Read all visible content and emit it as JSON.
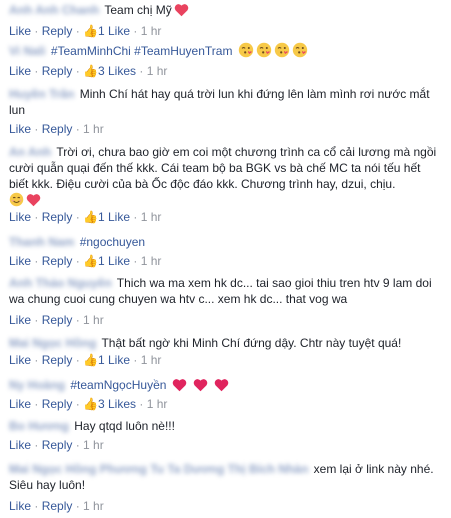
{
  "colors": {
    "link": "#365899",
    "meta": "#90949c",
    "text": "#1d2129",
    "heart": "#e9435f",
    "like_icon": "#5890ff"
  },
  "actions": {
    "like": "Like",
    "reply": "Reply",
    "sep": " · ",
    "thumb": "👍"
  },
  "comments": [
    {
      "author": "Anh Anh Chanh",
      "text": "Team chị Mỹ",
      "likes": "1 Like",
      "time": "1 hr",
      "emoji": [
        "heart"
      ]
    },
    {
      "author": "Vi Nali",
      "text": "#TeamMinhChi #TeamHuyenTram",
      "likes": "3 Likes",
      "time": "1 hr",
      "emoji": [
        "kiss",
        "kiss",
        "kiss",
        "kiss"
      ]
    },
    {
      "author": "Huyền Trân",
      "text": "Minh Chí hát hay quá trời lun khi đứng lên làm mình rơi nước mắt lun",
      "likes": "",
      "time": "1 hr",
      "emoji": []
    },
    {
      "author": "An Anh",
      "text": "Trời ơi, chưa bao giờ em coi một chương trình ca cổ cải lương mà ngồi cười quẫn quại đến thế kkk. Cái team bộ ba BGK vs bà chế MC ta nói tếu hết biết kkk. Điệu cười của bà Ốc độc đáo kkk. Chương trình hay, dzui, chịu.",
      "likes": "1 Like",
      "time": "1 hr",
      "emoji": [
        "smile",
        "heart"
      ]
    },
    {
      "author": "Thanh Nam",
      "text": "#ngochuyen",
      "likes": "1 Like",
      "time": "1 hr",
      "emoji": []
    },
    {
      "author": "Anh Thảo Nguyên",
      "text": "Thich wa ma xem hk dc... tai sao gioi thiu tren htv 9 lam doi wa chung cuoi cung chuyen wa htv c... xem hk dc... that vog wa",
      "likes": "",
      "time": "1 hr",
      "emoji": []
    },
    {
      "author": "Mai Ngọc Hồng",
      "text": "Thật bất ngờ khi Minh Chí đứng dậy. Chtr này tuyệt quá!",
      "likes": "1 Like",
      "time": "1 hr",
      "emoji": []
    },
    {
      "author": "Ny Hoàng",
      "text": "#teamNgọcHuyền",
      "likes": "3 Likes",
      "time": "1 hr",
      "emoji": [
        "heart_red",
        "heart_red",
        "heart_red"
      ]
    },
    {
      "author": "Bo Hương",
      "text": "Hay qtqd luôn nè!!!",
      "likes": "",
      "time": "1 hr",
      "emoji": []
    },
    {
      "author": "Mai Ngọc Hồng Phương Tu Ta Dương Thị Bích Nhàn",
      "text": "xem lại ở link này nhé. Siêu hay luôn!",
      "likes": "",
      "time": "1 hr",
      "emoji": []
    }
  ]
}
